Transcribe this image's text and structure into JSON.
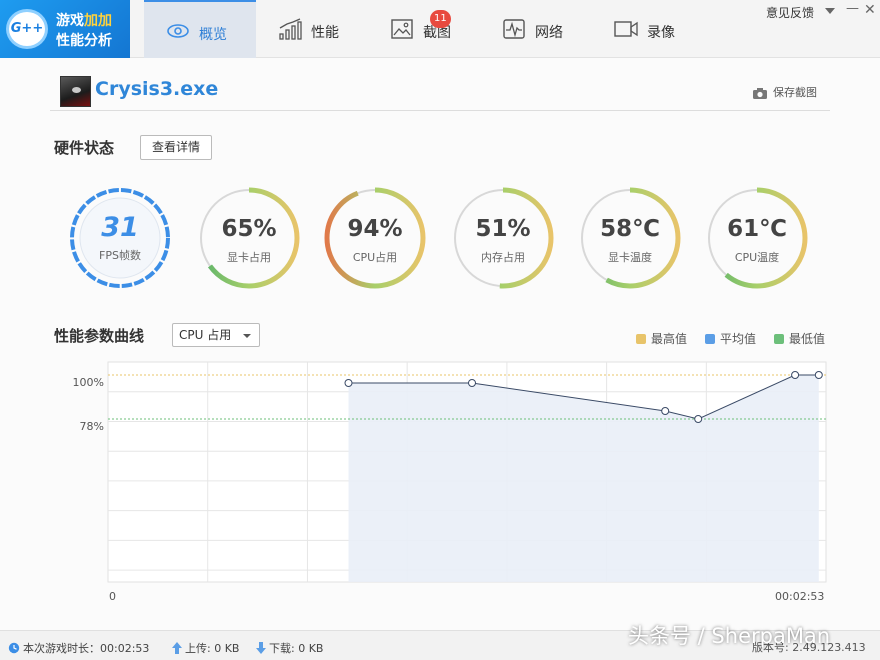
{
  "app": {
    "logo_badge": "G++",
    "logo_line1_a": "游戏",
    "logo_line1_b": "加加",
    "logo_line2": "性能分析"
  },
  "tabs": [
    {
      "label": "概览",
      "icon": "eye-icon",
      "active": true
    },
    {
      "label": "性能",
      "icon": "bar-chart-icon",
      "active": false
    },
    {
      "label": "截图",
      "icon": "picture-icon",
      "active": false,
      "badge": "11"
    },
    {
      "label": "网络",
      "icon": "pulse-icon",
      "active": false
    },
    {
      "label": "录像",
      "icon": "video-camera-icon",
      "active": false
    }
  ],
  "window": {
    "feedback": "意见反馈"
  },
  "game": {
    "name": "Crysis3.exe",
    "save_screenshot": "保存截图"
  },
  "hardware": {
    "title": "硬件状态",
    "detail_button": "查看详情",
    "fps": {
      "value": "31",
      "label": "FPS帧数"
    },
    "gauges": [
      {
        "value": "65%",
        "label": "显卡占用",
        "fraction": 0.65
      },
      {
        "value": "94%",
        "label": "CPU占用",
        "fraction": 0.94
      },
      {
        "value": "51%",
        "label": "内存占用",
        "fraction": 0.51
      },
      {
        "value": "58℃",
        "label": "显卡温度",
        "fraction": 0.58
      },
      {
        "value": "61℃",
        "label": "CPU温度",
        "fraction": 0.61
      }
    ]
  },
  "curve": {
    "title": "性能参数曲线",
    "selected_metric": "CPU 占用",
    "legend": [
      {
        "label": "最高值",
        "color": "#e8c46a"
      },
      {
        "label": "平均值",
        "color": "#5b9ee6"
      },
      {
        "label": "最低值",
        "color": "#6cbf7a"
      }
    ]
  },
  "chart_data": {
    "type": "line",
    "y_ticks": [
      "100%",
      "78%"
    ],
    "x_tick_labels": [
      "0",
      "00:02:53"
    ],
    "max_value": 100,
    "min_value": 78,
    "points": [
      {
        "t": 0.335,
        "y": 96
      },
      {
        "t": 0.507,
        "y": 96
      },
      {
        "t": 0.776,
        "y": 82
      },
      {
        "t": 0.822,
        "y": 78
      },
      {
        "t": 0.957,
        "y": 100
      },
      {
        "t": 0.99,
        "y": 100
      }
    ]
  },
  "status": {
    "duration": "本次游戏时长：00:02:53",
    "upload": "上传: 0 KB",
    "download": "下载: 0 KB",
    "version": "版本号: 2.49.123.413",
    "watermark": "头条号 / SherpaMan"
  }
}
